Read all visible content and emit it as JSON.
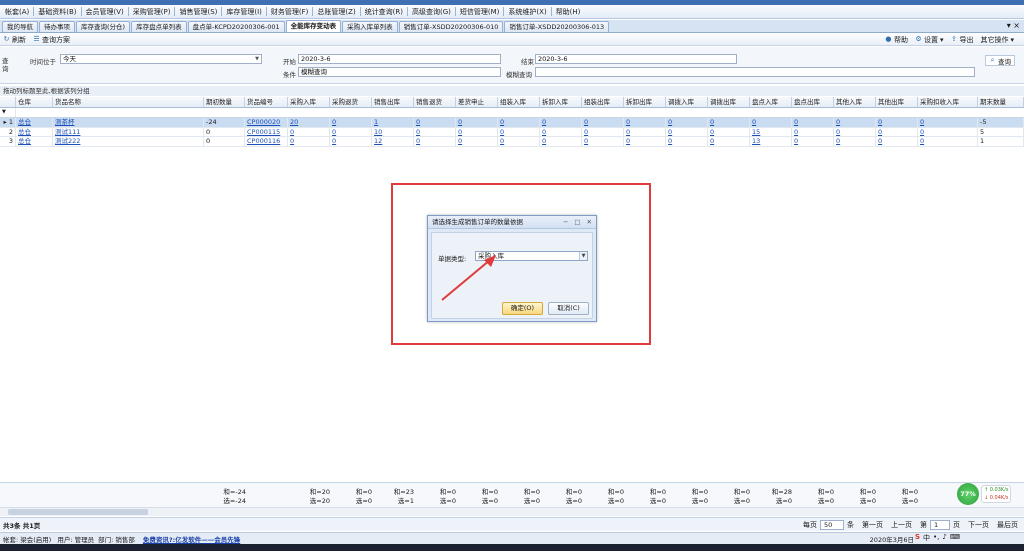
{
  "menus": [
    "帐套(A)",
    "基础资料(B)",
    "会员管理(V)",
    "采购管理(P)",
    "销售管理(S)",
    "库存管理(I)",
    "财务管理(F)",
    "总账管理(Z)",
    "统计查询(R)",
    "高级查询(G)",
    "短信管理(M)",
    "系统维护(X)",
    "帮助(H)"
  ],
  "tabs": [
    "我的导航",
    "待办事项",
    "库存查询(分仓)",
    "库存盘点单列表",
    "盘点单-KCPD20200306-001",
    "全能库存变动表",
    "采购入库单列表",
    "销售订单-XSDD20200306-010",
    "销售订单-XSDD20200306-013"
  ],
  "active_tab_index": 5,
  "toolbar": {
    "refresh": "刷新",
    "query_scheme": "查询方案",
    "help": "帮助",
    "settings": "设置",
    "export": "导出",
    "other": "其它操作"
  },
  "query": {
    "side_label": "查询",
    "time_label": "时间位于",
    "time_value": "今天",
    "start_label": "开始",
    "start_value": "2020-3-6",
    "end_label": "结束",
    "end_value": "2020-3-6",
    "condition_label": "条件",
    "condition_value": "模糊查询",
    "fuzzy_label": "模糊查询",
    "fuzzy_value": "",
    "search_button": "查询"
  },
  "group_hint": "拖动列标题至此,根据该列分组",
  "grid": {
    "columns": [
      "",
      "仓库",
      "货品名称",
      "期初数量",
      "货品编号",
      "采购入库",
      "采购退货",
      "销售出库",
      "销售退货",
      "差货申止",
      "组装入库",
      "拆卸入库",
      "组装出库",
      "拆卸出库",
      "调拨入库",
      "调拨出库",
      "盘点入库",
      "盘点出库",
      "其他入库",
      "其他出库",
      "采购扣收入库",
      "期末数量"
    ],
    "rows": [
      [
        "1",
        "总仓",
        "测茶杯",
        "-24",
        "CP000020",
        "20",
        "0",
        "1",
        "0",
        "0",
        "0",
        "0",
        "0",
        "0",
        "0",
        "0",
        "0",
        "0",
        "0",
        "0",
        "0",
        "-5"
      ],
      [
        "2",
        "总仓",
        "测试111",
        "0",
        "CP000115",
        "0",
        "0",
        "10",
        "0",
        "0",
        "0",
        "0",
        "0",
        "0",
        "0",
        "0",
        "15",
        "0",
        "0",
        "0",
        "0",
        "5"
      ],
      [
        "3",
        "总仓",
        "测试222",
        "0",
        "CP000116",
        "0",
        "0",
        "12",
        "0",
        "0",
        "0",
        "0",
        "0",
        "0",
        "0",
        "0",
        "13",
        "0",
        "0",
        "0",
        "0",
        "1"
      ]
    ],
    "selected_row": 0
  },
  "totals": {
    "cols": [
      [
        "和=-24",
        "选=-24"
      ],
      [
        "和=20",
        "选=20"
      ],
      [
        "和=0",
        "选=0"
      ],
      [
        "和=23",
        "选=1"
      ],
      [
        "和=0",
        "选=0"
      ],
      [
        "和=0",
        "选=0"
      ],
      [
        "和=0",
        "选=0"
      ],
      [
        "和=0",
        "选=0"
      ],
      [
        "和=0",
        "选=0"
      ],
      [
        "和=0",
        "选=0"
      ],
      [
        "和=0",
        "选=0"
      ],
      [
        "和=0",
        "选=0"
      ],
      [
        "和=28",
        "选=0"
      ],
      [
        "和=0",
        "选=0"
      ],
      [
        "和=0",
        "选=0"
      ],
      [
        "和=0",
        "选=0"
      ]
    ]
  },
  "pager": {
    "summary": "共3条 共1页",
    "per_page_label": "每页",
    "per_page_value": "50",
    "unit": "条",
    "first": "第一页",
    "prev": "上一页",
    "page_prefix": "第",
    "page_value": "1",
    "page_suffix": "页",
    "next": "下一页",
    "last": "最后页"
  },
  "status": {
    "ledger": "帐套: 梁会(启用)",
    "user": "用户: 管理员",
    "dept": "部门: 销售部",
    "promo": "免费资讯?:亿发软件——会员先锋",
    "date": "2020年3月6日"
  },
  "dialog": {
    "title": "请选择生成销售订单的数量依据",
    "doc_type_label": "单据类型:",
    "doc_type_value": "采购入库",
    "ok": "确定(O)",
    "cancel": "取消(C)"
  },
  "net": {
    "percent": "77%",
    "up": "0.03K/s",
    "down": "0.04K/s"
  },
  "colors": {
    "highlight": "#e03b3b",
    "selected": "#c9dcf2",
    "link": "#1d4fb8"
  }
}
